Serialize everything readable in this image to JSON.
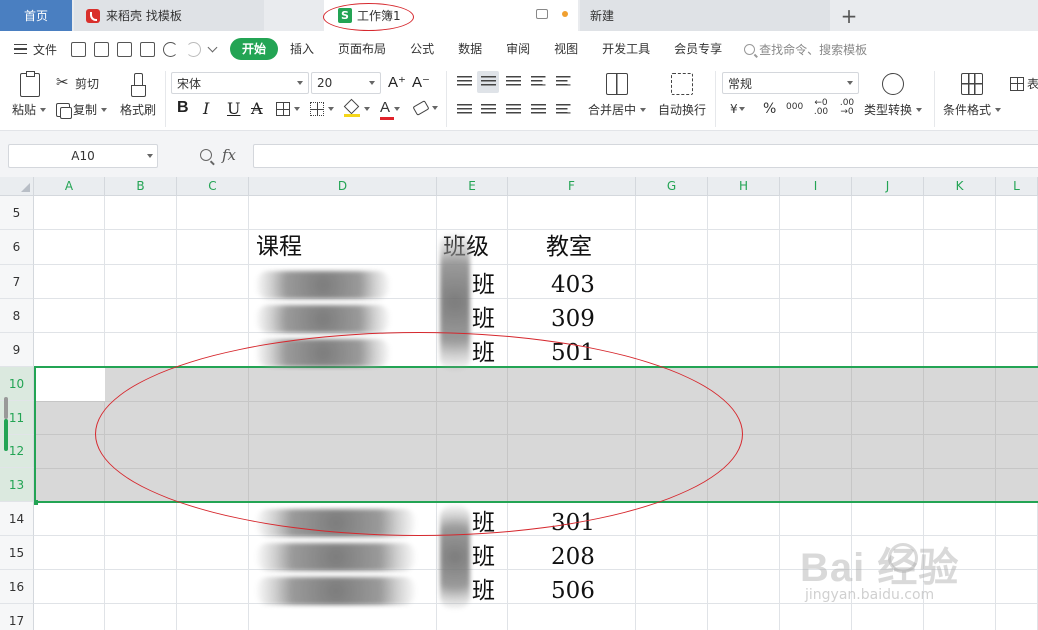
{
  "tabs": {
    "home": "首页",
    "daoke": "来稻壳 找模板",
    "workbook": "工作簿1",
    "new": "新建",
    "plus": "+"
  },
  "menu": {
    "file": "文件",
    "tabs": [
      "开始",
      "插入",
      "页面布局",
      "公式",
      "数据",
      "审阅",
      "视图",
      "开发工具",
      "会员专享"
    ],
    "active_tab": "开始",
    "search": "查找命令、搜索模板"
  },
  "ribbon": {
    "paste": "粘贴",
    "cut": "剪切",
    "copy": "复制",
    "format_painter": "格式刷",
    "font_name": "宋体",
    "font_size": "20",
    "grow": "A⁺",
    "shrink": "A⁻",
    "bold": "B",
    "italic": "I",
    "underline": "U",
    "strike": "A",
    "font_color": "A",
    "merge": "合并居中",
    "wrap": "自动换行",
    "number_format": "常规",
    "currency": "¥",
    "percent": "%",
    "thousands": "000",
    "inc_dec_a": "←0 .00",
    "inc_dec_b": ".00 →0",
    "convert": "类型转换",
    "cond_format": "条件格式",
    "table_style": "表"
  },
  "formula_bar": {
    "name_box": "A10",
    "fx": "fx",
    "content": ""
  },
  "columns": [
    "A",
    "B",
    "C",
    "D",
    "E",
    "F",
    "G",
    "H",
    "I",
    "J",
    "K",
    "L"
  ],
  "rows": [
    "5",
    "6",
    "7",
    "8",
    "9",
    "10",
    "11",
    "12",
    "13",
    "14",
    "15",
    "16",
    "17"
  ],
  "sheet": {
    "header": {
      "course": "课程",
      "class": "班级",
      "room": "教室"
    },
    "data_rows": [
      {
        "row": "7",
        "class": "班",
        "room": "403"
      },
      {
        "row": "8",
        "class": "班",
        "room": "309"
      },
      {
        "row": "9",
        "class": "班",
        "room": "501"
      },
      {
        "row": "14",
        "class": "班",
        "room": "301"
      },
      {
        "row": "15",
        "class": "班",
        "room": "208"
      },
      {
        "row": "16",
        "class": "班",
        "room": "506"
      }
    ]
  },
  "watermark": {
    "brand": "Bai  经验",
    "url": "jingyan.baidu.com"
  },
  "colors": {
    "accent": "#23a454",
    "annotation": "#d6282e",
    "selection": "#d8d8d8"
  }
}
